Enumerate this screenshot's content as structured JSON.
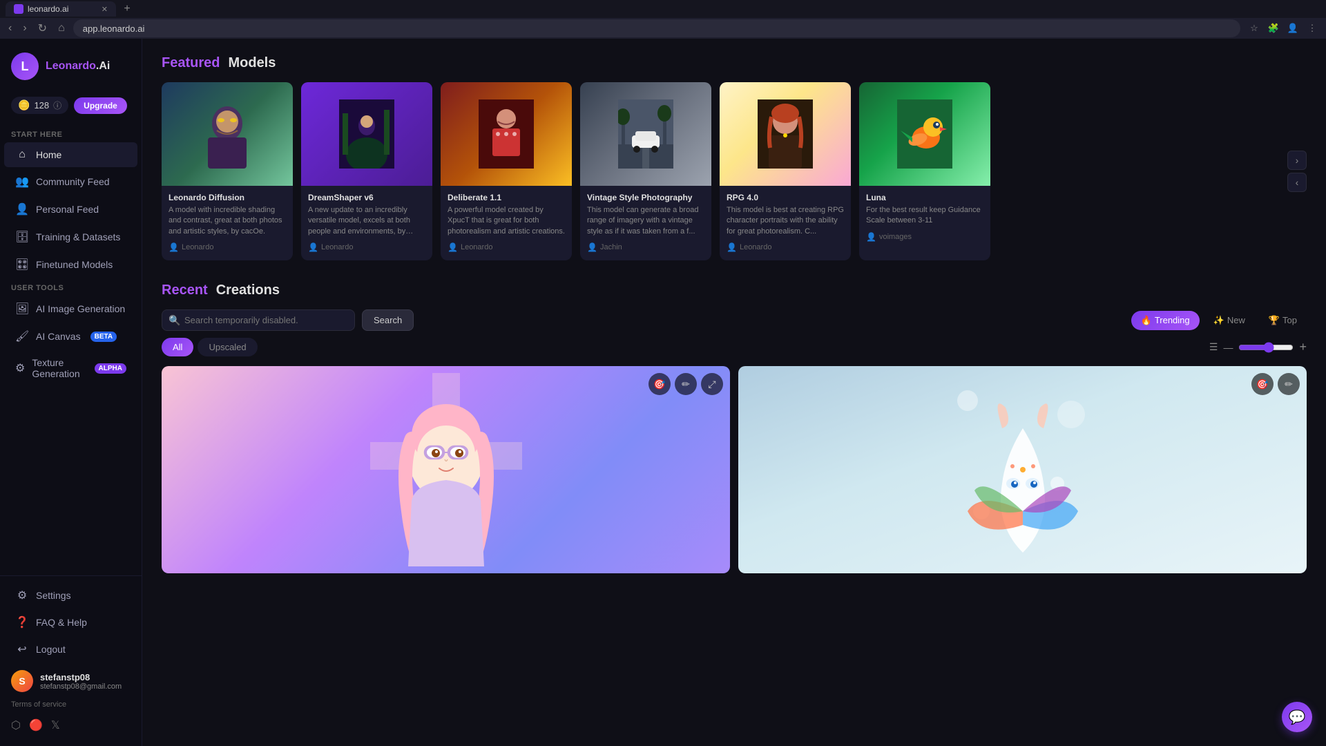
{
  "browser": {
    "tab_label": "leonardo.ai",
    "address": "app.leonardo.ai"
  },
  "sidebar": {
    "logo_text_highlight": "Leonardo",
    "logo_text_normal": ".Ai",
    "credits": "128",
    "upgrade_label": "Upgrade",
    "section_start_here": "Start Here",
    "nav_items": [
      {
        "id": "home",
        "label": "Home",
        "icon": "⌂",
        "active": true
      },
      {
        "id": "community-feed",
        "label": "Community Feed",
        "icon": "👥"
      },
      {
        "id": "personal-feed",
        "label": "Personal Feed",
        "icon": "👤"
      },
      {
        "id": "training",
        "label": "Training & Datasets",
        "icon": "🗄"
      },
      {
        "id": "finetuned",
        "label": "Finetuned Models",
        "icon": "🎛"
      }
    ],
    "user_tools_label": "User Tools",
    "tool_items": [
      {
        "id": "ai-image",
        "label": "AI Image Generation",
        "icon": "🖼"
      },
      {
        "id": "ai-canvas",
        "label": "AI Canvas",
        "icon": "🖌",
        "badge": "BETA",
        "badge_class": "badge-beta"
      },
      {
        "id": "texture",
        "label": "Texture Generation",
        "icon": "⚙",
        "badge": "ALPHA",
        "badge_class": "badge-alpha"
      }
    ],
    "bottom_items": [
      {
        "id": "settings",
        "label": "Settings",
        "icon": "⚙"
      },
      {
        "id": "faq",
        "label": "FAQ & Help",
        "icon": "❓"
      },
      {
        "id": "logout",
        "label": "Logout",
        "icon": "↩"
      }
    ],
    "user_name": "stefanstp08",
    "user_email": "stefanstp08@gmail.com",
    "terms_label": "Terms of service",
    "social_icons": [
      "discord",
      "reddit",
      "twitter"
    ]
  },
  "featured_models": {
    "title_highlight": "Featured",
    "title_normal": "Models",
    "models": [
      {
        "id": "leonardo-diffusion",
        "name": "Leonardo Diffusion",
        "desc": "A model with incredible shading and contrast, great at both photos and artistic styles, by cacOe.",
        "author": "Leonardo",
        "bg": "portrait1"
      },
      {
        "id": "dreamshaper-v6",
        "name": "DreamShaper v6",
        "desc": "A new update to an incredibly versatile model, excels at both people and environments, by Lykon.",
        "author": "Leonardo",
        "bg": "portrait3"
      },
      {
        "id": "deliberate-1-1",
        "name": "Deliberate 1.1",
        "desc": "A powerful model created by XpucT that is great for both photorealism and artistic creations.",
        "author": "Leonardo",
        "bg": "rpg"
      },
      {
        "id": "vintage-style",
        "name": "Vintage Style Photography",
        "desc": "This model can generate a broad range of imagery with a vintage style as if it was taken from a f...",
        "author": "Jachin",
        "bg": "car"
      },
      {
        "id": "rpg-4",
        "name": "RPG 4.0",
        "desc": "This model is best at creating RPG character portraits with the ability for great photorealism. C...",
        "author": "Leonardo",
        "bg": "portrait2"
      },
      {
        "id": "luna",
        "name": "Luna",
        "desc": "For the best result keep Guidance Scale between 3-11",
        "author": "voimages",
        "bg": "bird"
      }
    ]
  },
  "recent_creations": {
    "title_highlight": "Recent",
    "title_normal": "Creations",
    "search_placeholder": "Search temporarily disabled.",
    "search_btn_label": "Search",
    "filter_all": "All",
    "filter_upscaled": "Upscaled",
    "sort_trending": "Trending",
    "sort_new": "New",
    "sort_top": "Top",
    "images": [
      {
        "id": "img1",
        "bg": "girl-anime",
        "emoji": ""
      },
      {
        "id": "img2",
        "bg": "fantasy",
        "emoji": ""
      }
    ]
  }
}
